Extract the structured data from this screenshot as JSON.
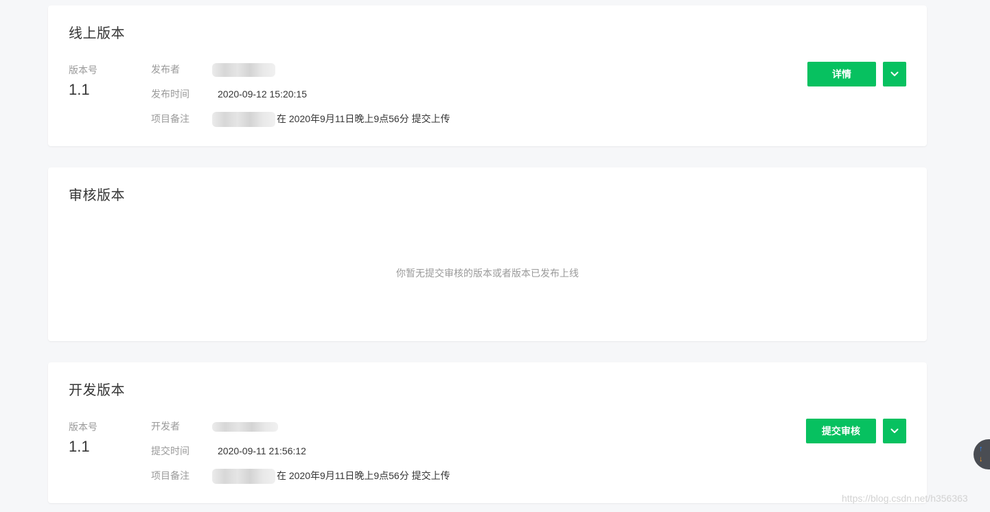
{
  "online": {
    "title": "线上版本",
    "version_label": "版本号",
    "version": "1.1",
    "rows": [
      {
        "label": "发布者",
        "value": ""
      },
      {
        "label": "发布时间",
        "value": "2020-09-12 15:20:15"
      },
      {
        "label": "项目备注",
        "value": "在 2020年9月11日晚上9点56分 提交上传"
      }
    ],
    "primary_button": "详情"
  },
  "review": {
    "title": "审核版本",
    "empty_text": "你暂无提交审核的版本或者版本已发布上线"
  },
  "dev": {
    "title": "开发版本",
    "version_label": "版本号",
    "version": "1.1",
    "rows": [
      {
        "label": "开发者",
        "value": ""
      },
      {
        "label": "提交时间",
        "value": "2020-09-11 21:56:12"
      },
      {
        "label": "项目备注",
        "value": "在 2020年9月11日晚上9点56分 提交上传"
      }
    ],
    "primary_button": "提交审核"
  },
  "icons": {
    "dropdown": "chevron-down-icon",
    "scroll_up": "arrow-up-icon",
    "scroll_down": "arrow-down-icon"
  },
  "colors": {
    "accent": "#07c160",
    "page_bg": "#f6f7f9",
    "card_bg": "#ffffff",
    "muted_text": "#9a9a9a"
  },
  "watermark": "https://blog.csdn.net/h356363"
}
